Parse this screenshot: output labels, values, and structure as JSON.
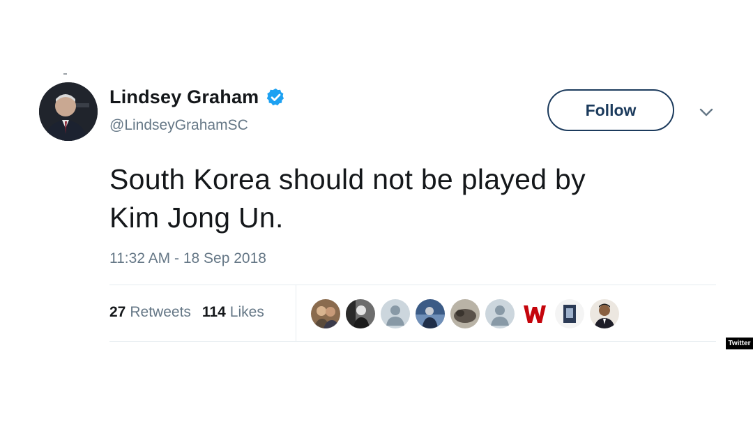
{
  "tweet": {
    "author": {
      "name": "Lindsey Graham",
      "handle": "@LindseyGrahamSC",
      "verified": true,
      "avatar_icon": "person-photo-icon"
    },
    "follow_label": "Follow",
    "more_icon": "chevron-down-icon",
    "text_line1": "South Korea should not be played by",
    "text_line2": "Kim Jong Un.",
    "timestamp": "11:32 AM - 18 Sep 2018",
    "stats": {
      "retweets_count": "27",
      "retweets_label": "Retweets",
      "likes_count": "114",
      "likes_label": "Likes"
    },
    "likers": [
      {
        "icon": "user-photo-icon"
      },
      {
        "icon": "user-photo-icon"
      },
      {
        "icon": "default-avatar-icon"
      },
      {
        "icon": "user-photo-icon"
      },
      {
        "icon": "user-photo-icon"
      },
      {
        "icon": "default-avatar-icon"
      },
      {
        "icon": "wisconsin-logo-icon"
      },
      {
        "icon": "user-photo-icon"
      },
      {
        "icon": "user-photo-icon"
      }
    ]
  },
  "source_tag": "Twitter",
  "colors": {
    "verified_blue": "#1da1f2",
    "follow_border": "#1b3a5c",
    "secondary_text": "#657786",
    "divider": "#e6ecf0"
  }
}
